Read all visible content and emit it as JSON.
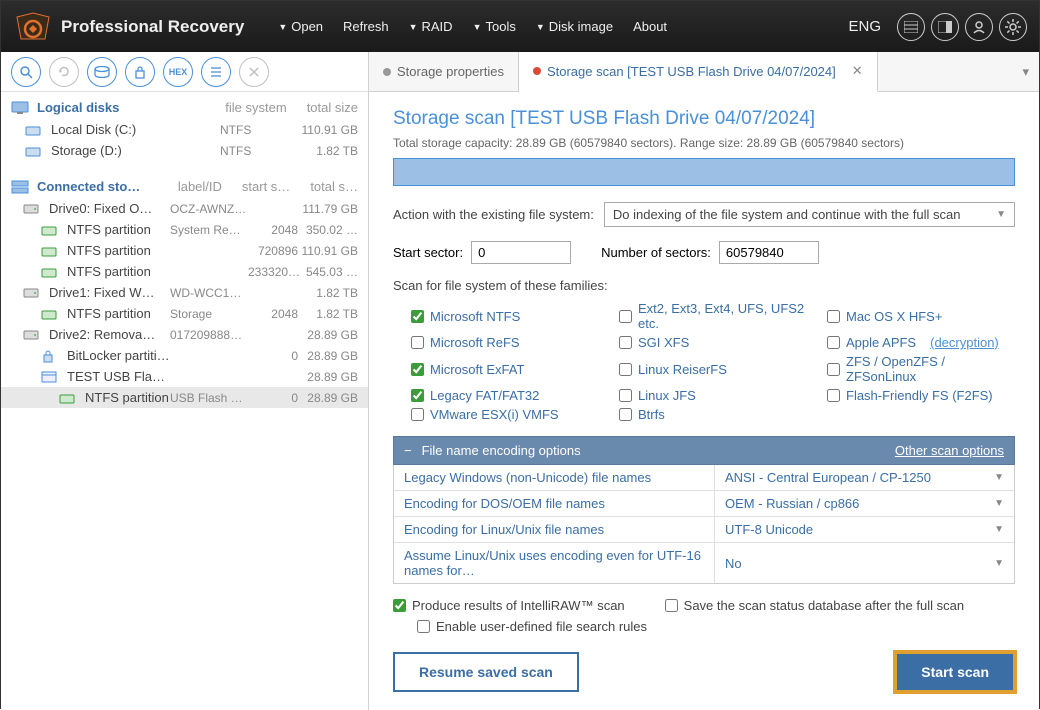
{
  "app": {
    "title": "Professional Recovery",
    "lang": "ENG"
  },
  "menu": {
    "open": "Open",
    "refresh": "Refresh",
    "raid": "RAID",
    "tools": "Tools",
    "diskimage": "Disk image",
    "about": "About"
  },
  "sidebar": {
    "logical": {
      "title": "Logical disks",
      "cols": [
        "file system",
        "total size"
      ],
      "rows": [
        {
          "name": "Local Disk (C:)",
          "fs": "NTFS",
          "size": "110.91 GB"
        },
        {
          "name": "Storage (D:)",
          "fs": "NTFS",
          "size": "1.82 TB"
        }
      ]
    },
    "connected": {
      "title": "Connected sto…",
      "cols": [
        "label/ID",
        "start s…",
        "total s…"
      ],
      "rows": [
        {
          "name": "Drive0: Fixed O…",
          "c1": "OCZ-AWNZ…",
          "c2": "",
          "c3": "111.79 GB",
          "lvl": 0,
          "disk": true
        },
        {
          "name": "NTFS partition",
          "c1": "System Re…",
          "c2": "2048",
          "c3": "350.02 …",
          "lvl": 1
        },
        {
          "name": "NTFS partition",
          "c1": "",
          "c2": "720896",
          "c3": "110.91 GB",
          "lvl": 1
        },
        {
          "name": "NTFS partition",
          "c1": "",
          "c2": "233320…",
          "c3": "545.03 …",
          "lvl": 1
        },
        {
          "name": "Drive1: Fixed W…",
          "c1": "WD-WCC1…",
          "c2": "",
          "c3": "1.82 TB",
          "lvl": 0,
          "disk": true
        },
        {
          "name": "NTFS partition",
          "c1": "Storage",
          "c2": "2048",
          "c3": "1.82 TB",
          "lvl": 1
        },
        {
          "name": "Drive2: Remova…",
          "c1": "017209888…",
          "c2": "",
          "c3": "28.89 GB",
          "lvl": 0,
          "disk": true
        },
        {
          "name": "BitLocker partiti…",
          "c1": "",
          "c2": "0",
          "c3": "28.89 GB",
          "lvl": 1,
          "lock": true
        },
        {
          "name": "TEST USB Flash…",
          "c1": "",
          "c2": "",
          "c3": "28.89 GB",
          "lvl": 1,
          "img": true
        },
        {
          "name": "NTFS partition",
          "c1": "USB Flash …",
          "c2": "0",
          "c3": "28.89 GB",
          "lvl": 2,
          "selected": true
        }
      ]
    }
  },
  "tabs": {
    "props": "Storage properties",
    "scan": "Storage scan [TEST USB Flash Drive 04/07/2024]"
  },
  "scan": {
    "title": "Storage scan [TEST USB Flash Drive 04/07/2024]",
    "capacity": "Total storage capacity: 28.89 GB (60579840 sectors). Range size: 28.89 GB (60579840 sectors)",
    "action_label": "Action with the existing file system:",
    "action_value": "Do indexing of the file system and continue with the full scan",
    "start_label": "Start sector:",
    "start_value": "0",
    "num_label": "Number of sectors:",
    "num_value": "60579840",
    "fs_label": "Scan for file system of these families:",
    "fs": [
      {
        "label": "Microsoft NTFS",
        "checked": true
      },
      {
        "label": "Ext2, Ext3, Ext4, UFS, UFS2 etc.",
        "checked": false
      },
      {
        "label": "Mac OS X HFS+",
        "checked": false
      },
      {
        "label": "Microsoft ReFS",
        "checked": false
      },
      {
        "label": "SGI XFS",
        "checked": false
      },
      {
        "label": "Apple APFS",
        "checked": false,
        "link": "(decryption)"
      },
      {
        "label": "Microsoft ExFAT",
        "checked": true
      },
      {
        "label": "Linux ReiserFS",
        "checked": false
      },
      {
        "label": "ZFS / OpenZFS / ZFSonLinux",
        "checked": false
      },
      {
        "label": "Legacy FAT/FAT32",
        "checked": true
      },
      {
        "label": "Linux JFS",
        "checked": false
      },
      {
        "label": "Flash-Friendly FS (F2FS)",
        "checked": false
      },
      {
        "label": "VMware ESX(i) VMFS",
        "checked": false
      },
      {
        "label": "Btrfs",
        "checked": false
      }
    ],
    "enc": {
      "title": "File name encoding options",
      "other": "Other scan options",
      "rows": [
        {
          "k": "Legacy Windows (non-Unicode) file names",
          "v": "ANSI - Central European / CP-1250"
        },
        {
          "k": "Encoding for DOS/OEM file names",
          "v": "OEM - Russian / cp866"
        },
        {
          "k": "Encoding for Linux/Unix file names",
          "v": "UTF-8 Unicode"
        },
        {
          "k": "Assume Linux/Unix uses encoding even for UTF-16 names for…",
          "v": "No"
        }
      ]
    },
    "intelliraw": "Produce results of IntelliRAW™ scan",
    "savestatus": "Save the scan status database after the full scan",
    "userrules": "Enable user-defined file search rules",
    "resume": "Resume saved scan",
    "start": "Start scan"
  }
}
